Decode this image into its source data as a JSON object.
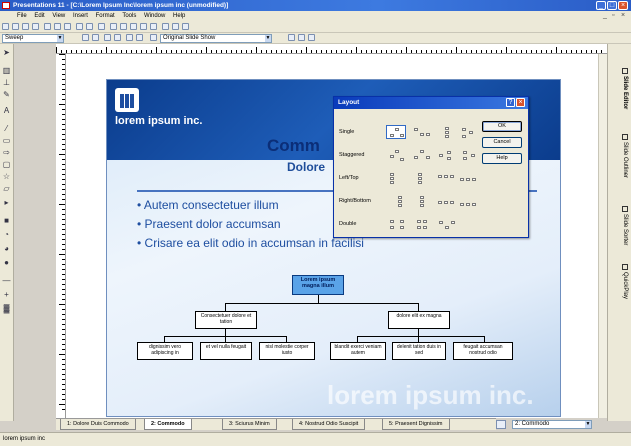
{
  "window": {
    "title": "Presentations 11 - [C:\\Lorem Ipsum Inc\\lorem ipsum inc (unmodified)]"
  },
  "menu": [
    "File",
    "Edit",
    "View",
    "Insert",
    "Format",
    "Tools",
    "Window",
    "Help"
  ],
  "toolbar": {
    "transition_select": "Sweep",
    "view_select": "Original Slide Show"
  },
  "slide": {
    "logo_text": "lorem ipsum inc.",
    "title": "Comm",
    "subtitle": "Dolore",
    "bullets": [
      "• Autem consectetuer illum",
      "• Praesent dolor accumsan",
      "• Crisare ea elit odio in accumsan in facilisi"
    ],
    "watermark": "lorem ipsum inc.",
    "org": {
      "top": "Lorem ipsum magna illum",
      "mid": [
        "Consectetuer dolore et tation",
        "dolore elit ex magna"
      ],
      "leaves": [
        "dignissim vero adipiscing in",
        "et vel nulla feugait",
        "nisl molestie corper iusto",
        "blandit exerci veniam autem",
        "delenit tation duis in sed",
        "feugait accumsan nostrud odio"
      ]
    }
  },
  "layout_dialog": {
    "title": "Layout",
    "rows": [
      "Single",
      "Staggered",
      "Left/Top",
      "Right/Bottom",
      "Double"
    ],
    "buttons": {
      "ok": "OK",
      "cancel": "Cancel",
      "help": "Help"
    }
  },
  "side_tabs": [
    "Slide Editor",
    "Slide Outliner",
    "Slide Sorter",
    "QuickPlay"
  ],
  "bottom_tabs": [
    "1: Dolore Duis Commodo",
    "2: Commodo",
    "3: Sciurus Minim",
    "4: Nostrud Odio Suscipit",
    "5: Praesent Dignissim"
  ],
  "zoom_select": "2: Commodo",
  "status": "lorem ipsum inc"
}
